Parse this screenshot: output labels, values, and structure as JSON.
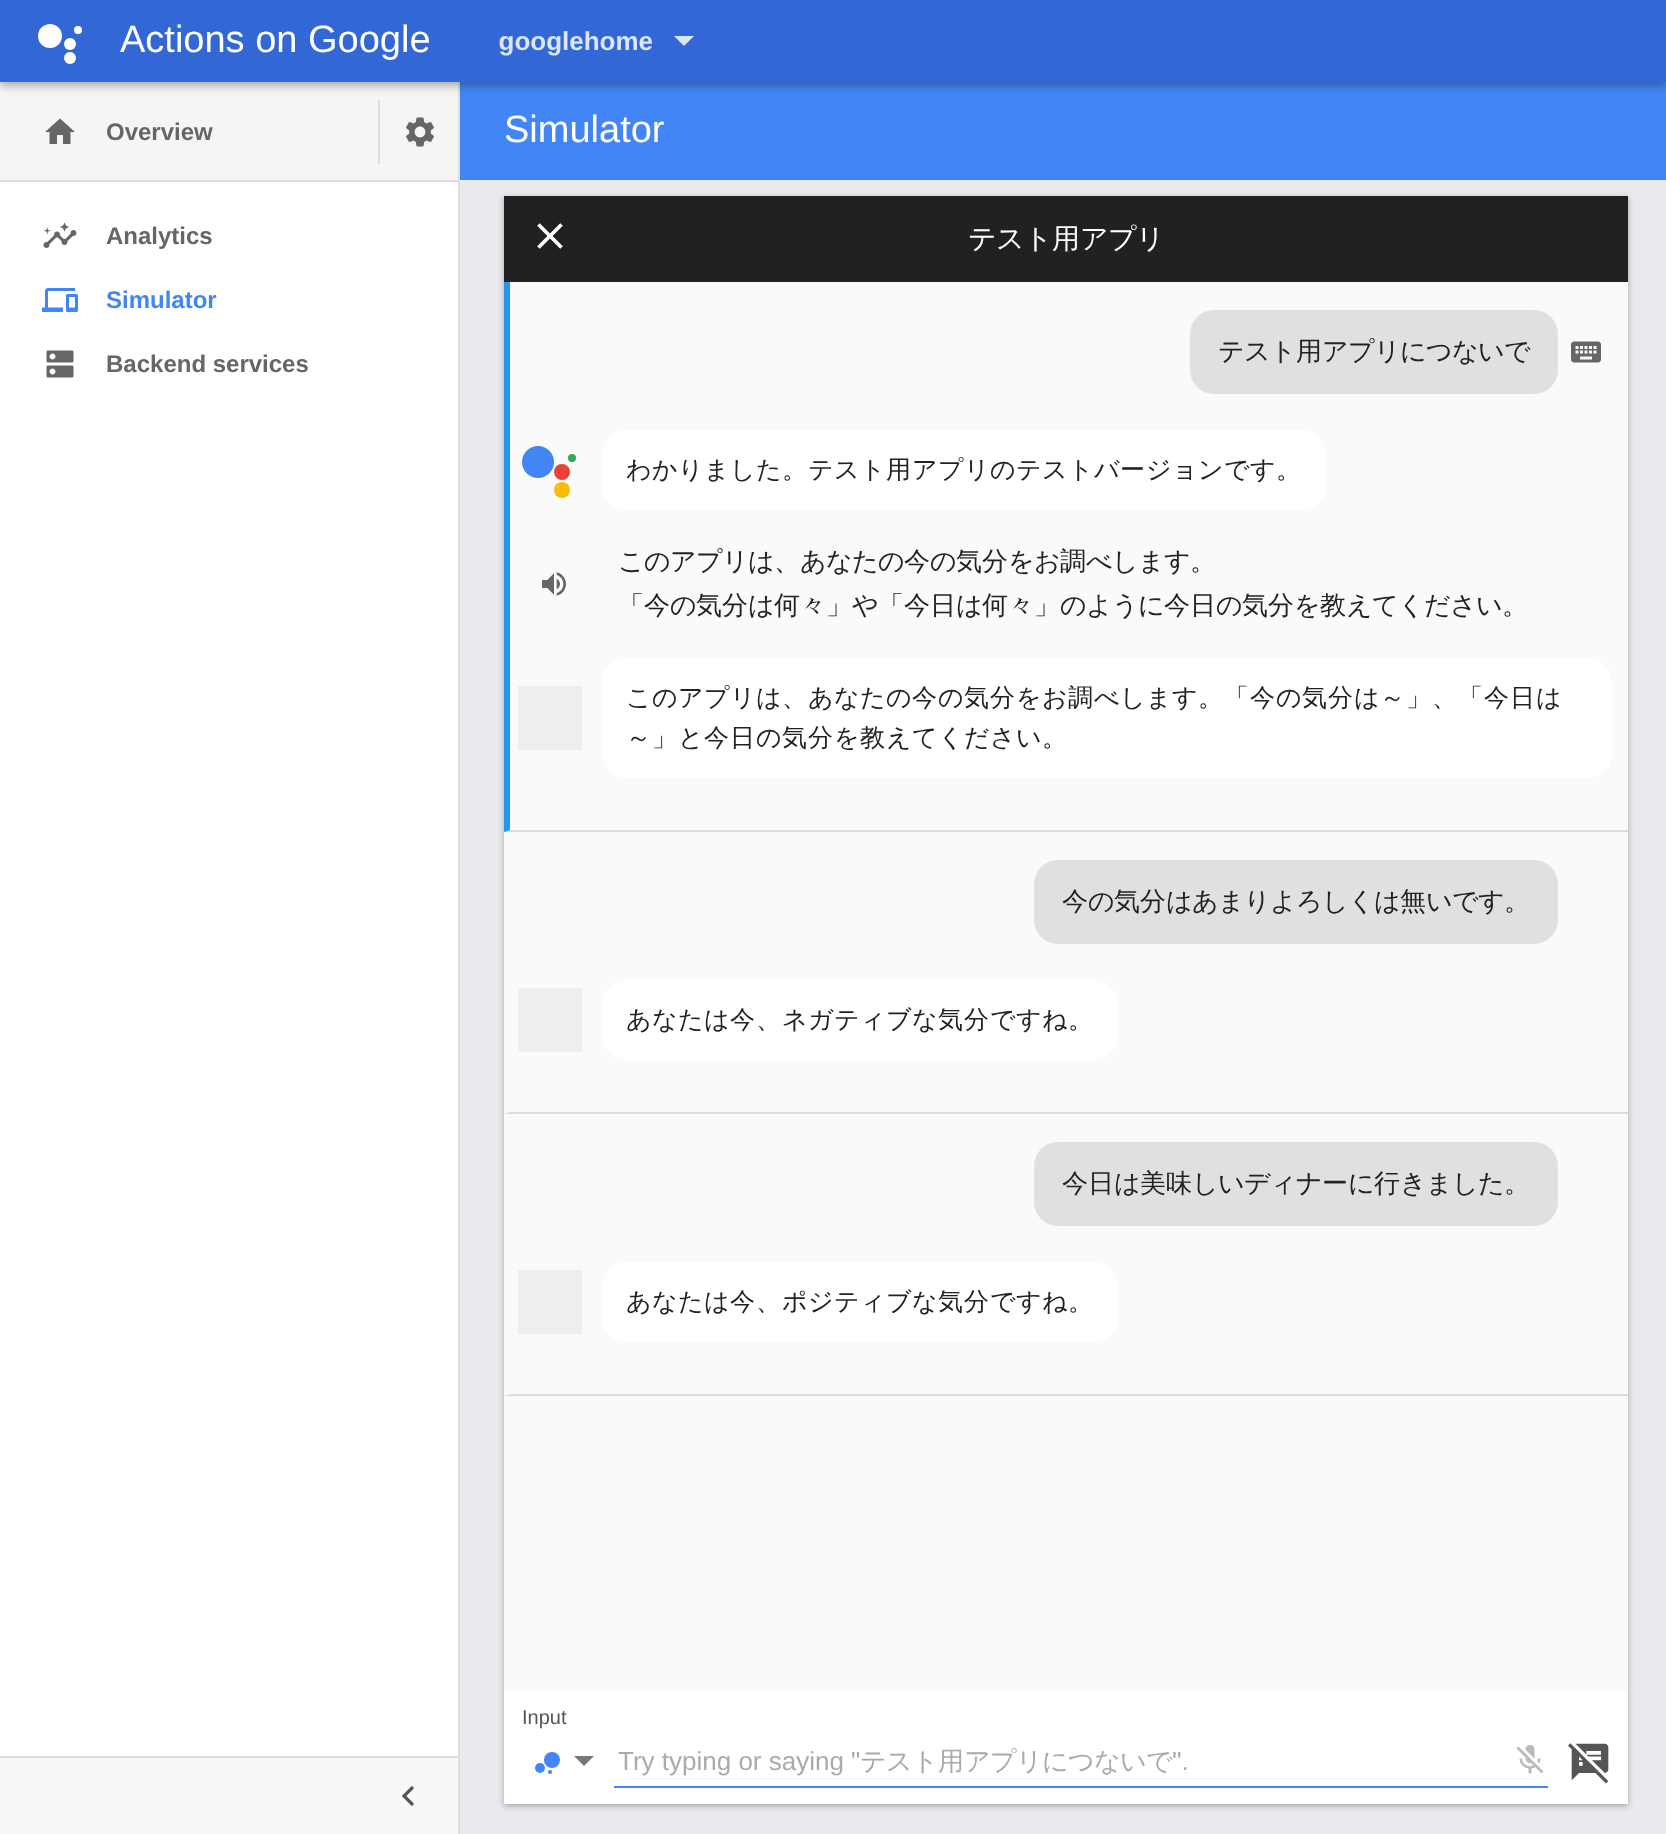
{
  "topbar": {
    "title": "Actions on Google",
    "project": "googlehome"
  },
  "sidebar": {
    "overview": "Overview",
    "items": [
      {
        "label": "Analytics",
        "selected": false
      },
      {
        "label": "Simulator",
        "selected": true
      },
      {
        "label": "Backend services",
        "selected": false
      }
    ]
  },
  "page_title": "Simulator",
  "simulator": {
    "title": "テスト用アプリ",
    "turns": [
      {
        "active": true,
        "messages": [
          {
            "kind": "user",
            "text": "テスト用アプリにつないで",
            "typed": true
          },
          {
            "kind": "greeting",
            "text": "わかりました。テスト用アプリのテストバージョンです。"
          },
          {
            "kind": "speech",
            "lines": [
              "このアプリは、あなたの今の気分をお調べします。",
              "「今の気分は何々」や「今日は何々」のように今日の気分を教えてください。"
            ]
          },
          {
            "kind": "assistant",
            "text": "このアプリは、あなたの今の気分をお調べします。「今の気分は～」、「今日は～」と今日の気分を教えてください。"
          }
        ]
      },
      {
        "active": false,
        "messages": [
          {
            "kind": "user",
            "text": "今の気分はあまりよろしくは無いです。",
            "typed": false
          },
          {
            "kind": "assistant",
            "text": "あなたは今、ネガティブな気分ですね。"
          }
        ]
      },
      {
        "active": false,
        "messages": [
          {
            "kind": "user",
            "text": "今日は美味しいディナーに行きました。",
            "typed": false
          },
          {
            "kind": "assistant",
            "text": "あなたは今、ポジティブな気分ですね。"
          }
        ]
      }
    ],
    "input": {
      "label": "Input",
      "placeholder": "Try typing or saying \"テスト用アプリにつないで\"."
    }
  }
}
